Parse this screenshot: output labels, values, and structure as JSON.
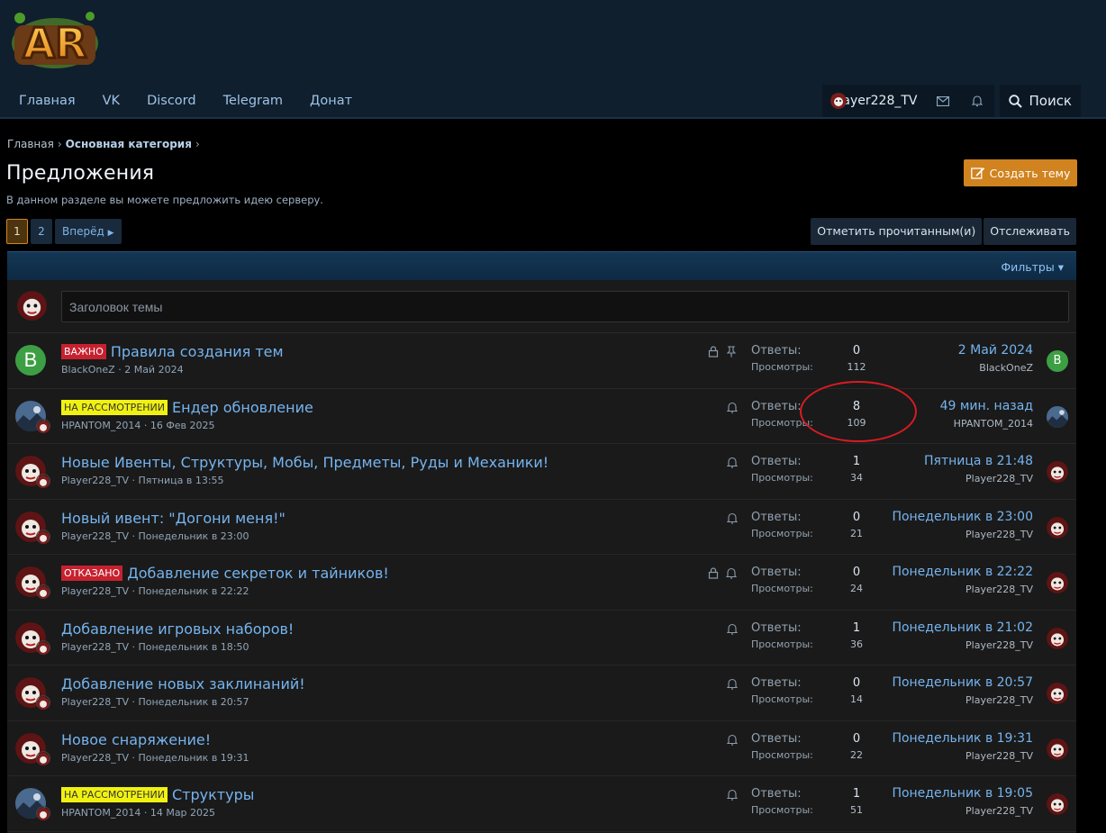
{
  "nav": {
    "tabs": [
      "Главная",
      "VK",
      "Discord",
      "Telegram",
      "Донат"
    ],
    "user": "Player228_TV",
    "search_label": "Поиск"
  },
  "breadcrumb": {
    "home": "Главная",
    "current": "Основная категория"
  },
  "page": {
    "title": "Предложения",
    "description": "В данном разделе вы можете предложить идею серверу.",
    "create_label": "Создать тему"
  },
  "pager": {
    "pages": [
      "1",
      "2"
    ],
    "current": "1",
    "next_label": "Вперёд"
  },
  "actions": {
    "mark_read": "Отметить прочитанным(и)",
    "watch": "Отслеживать"
  },
  "filters_label": "Фильтры",
  "quick_placeholder": "Заголовок темы",
  "stat_labels": {
    "replies": "Ответы:",
    "views": "Просмотры:"
  },
  "threads": [
    {
      "badge": "ВАЖНО",
      "badge_color": "#c7212f",
      "title": "Правила создания тем",
      "author": "BlackOneZ",
      "date": "2 Май 2024",
      "replies": "0",
      "views": "112",
      "last_date": "2 Май 2024",
      "last_user": "BlackOneZ",
      "icons": [
        "lock-icon",
        "pin-icon"
      ]
    },
    {
      "badge": "НА РАССМОТРЕНИИ",
      "badge_color": "#f1f111",
      "title": "Ендер обновление",
      "author": "HPANTOM_2014",
      "date": "16 Фев 2025",
      "replies": "8",
      "views": "109",
      "last_date": "49 мин. назад",
      "last_user": "HPANTOM_2014",
      "icons": [
        "bell-icon"
      ]
    },
    {
      "badge": "",
      "title": "Новые Ивенты, Структуры, Мобы, Предметы, Руды и Механики!",
      "author": "Player228_TV",
      "date": "Пятница в 13:55",
      "replies": "1",
      "views": "34",
      "last_date": "Пятница в 21:48",
      "last_user": "Player228_TV",
      "icons": [
        "bell-icon"
      ]
    },
    {
      "badge": "",
      "title": "Новый ивент: \"Догони меня!\"",
      "author": "Player228_TV",
      "date": "Понедельник в 23:00",
      "replies": "0",
      "views": "21",
      "last_date": "Понедельник в 23:00",
      "last_user": "Player228_TV",
      "icons": [
        "bell-icon"
      ]
    },
    {
      "badge": "ОТКАЗАНО",
      "badge_color": "#c7212f",
      "title": "Добавление секреток и тайников!",
      "author": "Player228_TV",
      "date": "Понедельник в 22:22",
      "replies": "0",
      "views": "24",
      "last_date": "Понедельник в 22:22",
      "last_user": "Player228_TV",
      "icons": [
        "lock-icon",
        "bell-icon"
      ]
    },
    {
      "badge": "",
      "title": "Добавление игровых наборов!",
      "author": "Player228_TV",
      "date": "Понедельник в 18:50",
      "replies": "1",
      "views": "36",
      "last_date": "Понедельник в 21:02",
      "last_user": "Player228_TV",
      "icons": [
        "bell-icon"
      ]
    },
    {
      "badge": "",
      "title": "Добавление новых заклинаний!",
      "author": "Player228_TV",
      "date": "Понедельник в 20:57",
      "replies": "0",
      "views": "14",
      "last_date": "Понедельник в 20:57",
      "last_user": "Player228_TV",
      "icons": [
        "bell-icon"
      ]
    },
    {
      "badge": "",
      "title": "Новое снаряжение!",
      "author": "Player228_TV",
      "date": "Понедельник в 19:31",
      "replies": "0",
      "views": "22",
      "last_date": "Понедельник в 19:31",
      "last_user": "Player228_TV",
      "icons": [
        "bell-icon"
      ]
    },
    {
      "badge": "НА РАССМОТРЕНИИ",
      "badge_color": "#f1f111",
      "title": "Структуры",
      "author": "HPANTOM_2014",
      "date": "14 Мар 2025",
      "replies": "1",
      "views": "51",
      "last_date": "Понедельник в 19:05",
      "last_user": "Player228_TV",
      "icons": [
        "bell-icon"
      ]
    }
  ],
  "colors": {
    "accent": "#d0831f",
    "link": "#75b4ef",
    "header": "#0f1f2d"
  }
}
